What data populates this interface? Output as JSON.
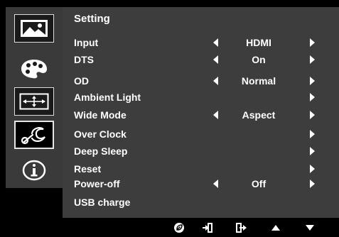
{
  "title": "Setting",
  "sidebar": {
    "items": [
      {
        "icon": "picture-icon"
      },
      {
        "icon": "color-palette-icon"
      },
      {
        "icon": "display-size-icon"
      },
      {
        "icon": "settings-wrench-icon",
        "active": true
      },
      {
        "icon": "info-icon"
      }
    ]
  },
  "menu": {
    "items": [
      {
        "label": "Input",
        "value": "HDMI"
      },
      {
        "label": "DTS",
        "value": "On"
      },
      {
        "label": "OD",
        "value": "Normal"
      },
      {
        "label": "Ambient Light",
        "value": ""
      },
      {
        "label": "Wide Mode",
        "value": "Aspect"
      },
      {
        "label": "Over Clock",
        "value": ""
      },
      {
        "label": "Deep Sleep",
        "value": ""
      },
      {
        "label": "Reset",
        "value": ""
      },
      {
        "label": "Power-off",
        "value": "Off"
      },
      {
        "label": "USB charge",
        "value": ""
      }
    ]
  },
  "keys": [
    "eco-icon",
    "enter-icon",
    "exit-icon",
    "up-arrow-icon",
    "down-arrow-icon"
  ]
}
